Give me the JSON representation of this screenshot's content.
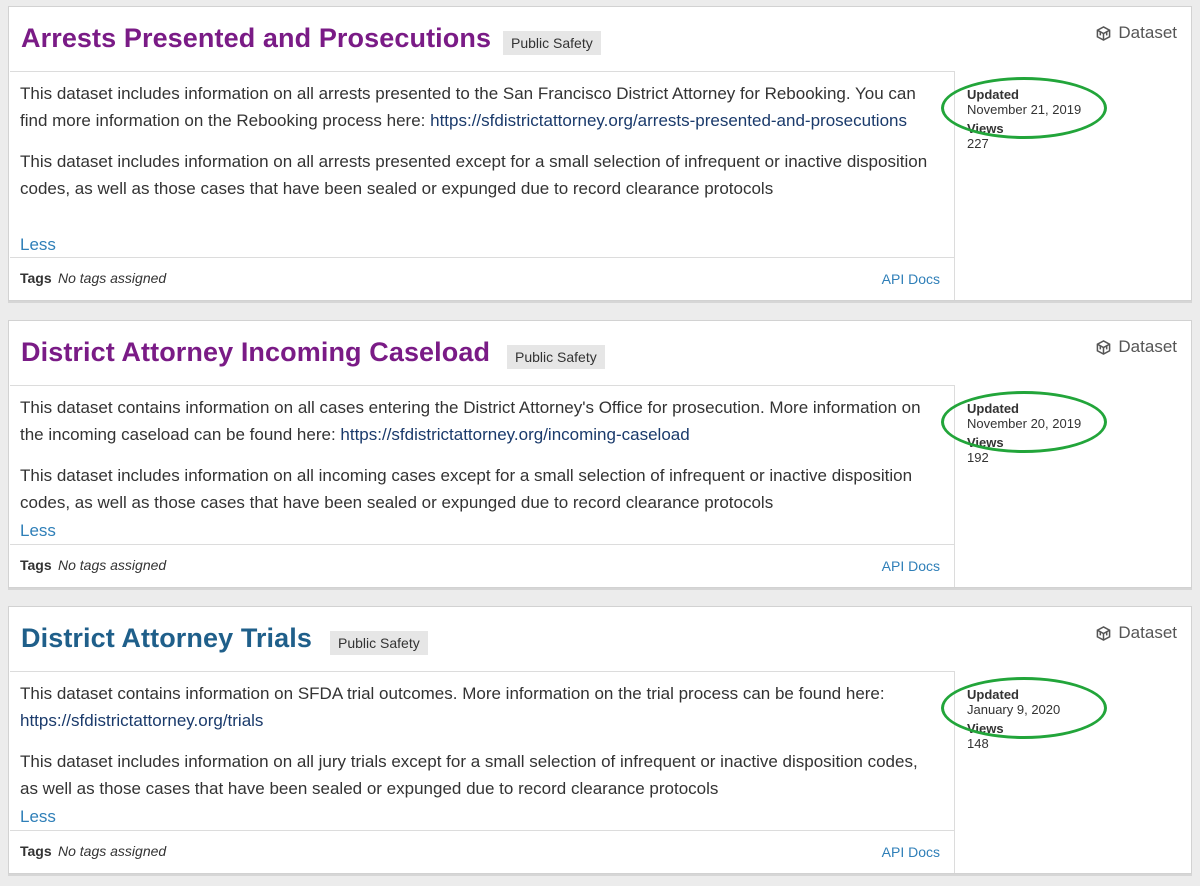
{
  "colors": {
    "title_purple": "#7a1b86",
    "title_blue": "#1f5f8a",
    "link_blue": "#2f7fb8",
    "highlight_green": "#22a53a"
  },
  "type_icon": "cube-icon",
  "datasets": [
    {
      "title": "Arrests Presented and Prosecutions",
      "category": "Public Safety",
      "type": "Dataset",
      "description_1": "This dataset includes information on all arrests presented to the San Francisco District Attorney for Rebooking. You can find more information on the Rebooking process here: ",
      "description_1_link": "https://sfdistrictattorney.org/arrests-presented-and-prosecutions",
      "description_2": "This dataset includes information on all arrests presented except for a small selection of infrequent or inactive disposition codes, as well as those cases that have been sealed or expunged due to record clearance protocols",
      "less": "Less",
      "tags_label": "Tags",
      "tags_value": "No tags assigned",
      "api_docs": "API Docs",
      "updated_label": "Updated",
      "updated_date": "November 21, 2019",
      "views_label": "Views",
      "views": "227"
    },
    {
      "title": "District Attorney Incoming Caseload",
      "category": "Public Safety",
      "type": "Dataset",
      "description_1": "This dataset contains information on all cases entering the District Attorney's Office for prosecution. More information on the incoming caseload can be found here: ",
      "description_1_link": "https://sfdistrictattorney.org/incoming-caseload",
      "description_2": "This dataset includes information on all incoming cases except for a small selection of infrequent or inactive disposition codes, as well as those cases that have been sealed or expunged due to record clearance protocols",
      "less": "Less",
      "tags_label": "Tags",
      "tags_value": "No tags assigned",
      "api_docs": "API Docs",
      "updated_label": "Updated",
      "updated_date": "November 20, 2019",
      "views_label": "Views",
      "views": "192"
    },
    {
      "title": "District Attorney Trials",
      "category": "Public Safety",
      "type": "Dataset",
      "description_1": "This dataset contains information on SFDA trial outcomes. More information on the trial process can be found here: ",
      "description_1_link": "https://sfdistrictattorney.org/trials",
      "description_2": "This dataset includes information on all jury trials except for a small selection of infrequent or inactive disposition codes, as well as those cases that have been sealed or expunged due to record clearance protocols",
      "less": "Less",
      "tags_label": "Tags",
      "tags_value": "No tags assigned",
      "api_docs": "API Docs",
      "updated_label": "Updated",
      "updated_date": "January 9, 2020",
      "views_label": "Views",
      "views": "148"
    }
  ]
}
